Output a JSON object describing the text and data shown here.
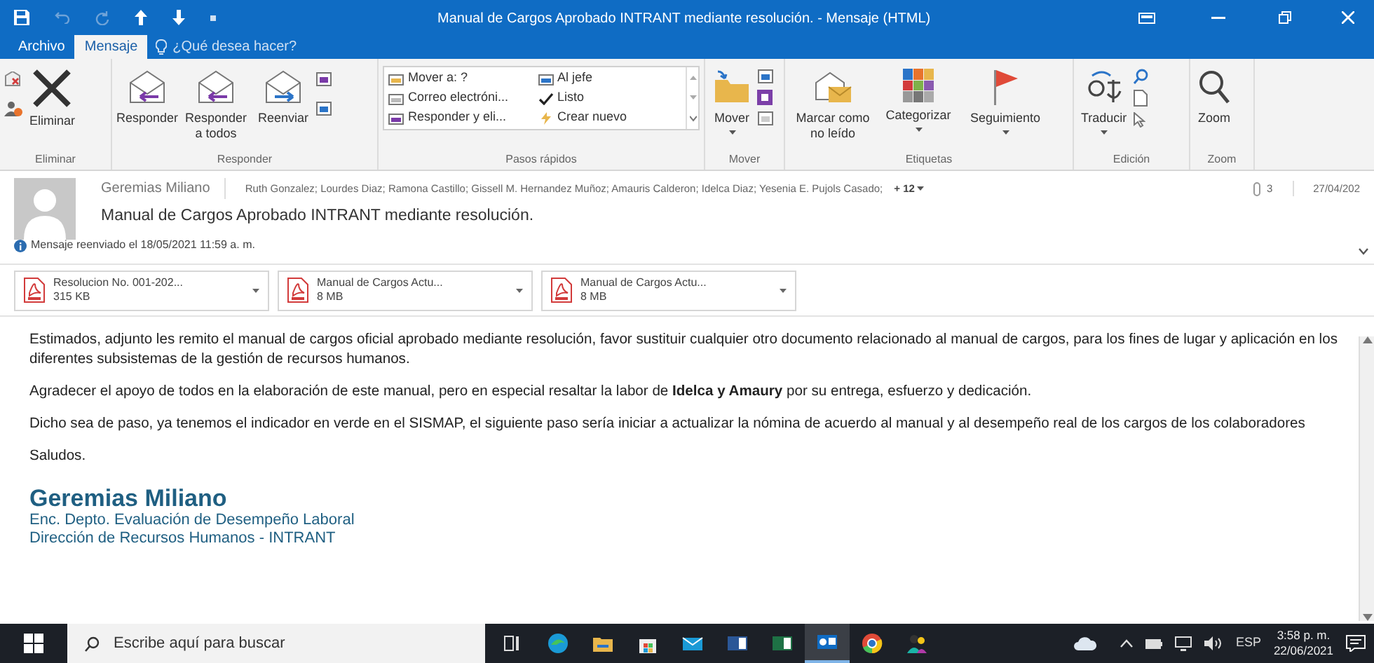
{
  "window": {
    "title": "Manual de Cargos Aprobado INTRANT mediante resolución. - Mensaje (HTML)"
  },
  "tabs": [
    {
      "label": "Archivo",
      "selected": false
    },
    {
      "label": "Mensaje",
      "selected": true
    }
  ],
  "tell_me": {
    "placeholder": "¿Qué desea hacer?"
  },
  "ribbon": [
    {
      "label": "Eliminar",
      "buttons": [
        {
          "label": "Eliminar",
          "has_menu": false
        }
      ]
    },
    {
      "label": "Responder",
      "buttons": [
        {
          "label": "Responder",
          "has_menu": false
        },
        {
          "label": "Responder a todos",
          "has_menu": false
        },
        {
          "label": "Reenviar",
          "has_menu": false
        }
      ]
    },
    {
      "label": "Pasos rápidos",
      "quick_steps": [
        "Mover a: ?",
        "Correo electróni...",
        "Responder y eli...",
        "Al jefe",
        "Listo",
        "Crear nuevo"
      ]
    },
    {
      "label": "Mover",
      "buttons": [
        {
          "label": "Mover",
          "has_menu": true
        }
      ]
    },
    {
      "label": "Etiquetas",
      "buttons": [
        {
          "label": "Marcar como no leído",
          "has_menu": false
        },
        {
          "label": "Categorizar",
          "has_menu": true
        },
        {
          "label": "Seguimiento",
          "has_menu": true
        }
      ]
    },
    {
      "label": "Edición",
      "buttons": [
        {
          "label": "Traducir",
          "has_menu": true
        }
      ]
    },
    {
      "label": "Zoom",
      "buttons": [
        {
          "label": "Zoom",
          "has_menu": false
        }
      ]
    }
  ],
  "message": {
    "sender": "Geremias Miliano",
    "recipients": "Ruth Gonzalez; Lourdes Diaz; Ramona Castillo; Gissell M. Hernandez Muñoz; Amauris Calderon; Idelca Diaz; Yesenia E. Pujols Casado;",
    "more_recipients": "+ 12",
    "attachment_count": "3",
    "date": "27/04/202",
    "subject": "Manual de Cargos Aprobado INTRANT mediante resolución.",
    "info": "Mensaje reenviado el 18/05/2021 11:59 a. m."
  },
  "attachments": [
    {
      "name": "Resolucion No. 001-202...",
      "size": "315 KB"
    },
    {
      "name": "Manual de Cargos Actu...",
      "size": "8 MB"
    },
    {
      "name": "Manual de Cargos Actu...",
      "size": "8 MB"
    }
  ],
  "body": [
    "Estimados, adjunto les remito el manual de cargos oficial aprobado mediante resolución, favor sustituir cualquier otro documento relacionado al manual de cargos, para los fines de lugar y aplicación en los diferentes subsistemas de la gestión de recursos humanos.",
    "Agradecer el apoyo de todos en la elaboración de este manual, pero en especial resaltar la labor de **Idelca y Amaury** por su entrega, esfuerzo y dedicación.",
    "Dicho sea de paso, ya tenemos el indicador en verde en el SISMAP, el siguiente paso sería iniciar a actualizar la nómina de acuerdo al manual y al desempeño real de los cargos de los colaboradores",
    "Saludos."
  ],
  "signature": {
    "name": "Geremias Miliano",
    "lines": [
      "Enc. Depto. Evaluación de Desempeño Laboral",
      "Dirección de Recursos Humanos - INTRANT"
    ]
  },
  "taskbar": {
    "search": {
      "placeholder": "Escribe aquí para buscar"
    },
    "apps": [
      {
        "selected": false
      },
      {
        "selected": false
      },
      {
        "selected": false
      },
      {
        "selected": false
      },
      {
        "selected": false
      },
      {
        "selected": false
      },
      {
        "selected": false
      },
      {
        "selected": true
      },
      {
        "selected": false
      },
      {
        "selected": false
      }
    ],
    "language": "ESP",
    "time": "3:58 p. m.",
    "date": "22/06/2021"
  }
}
